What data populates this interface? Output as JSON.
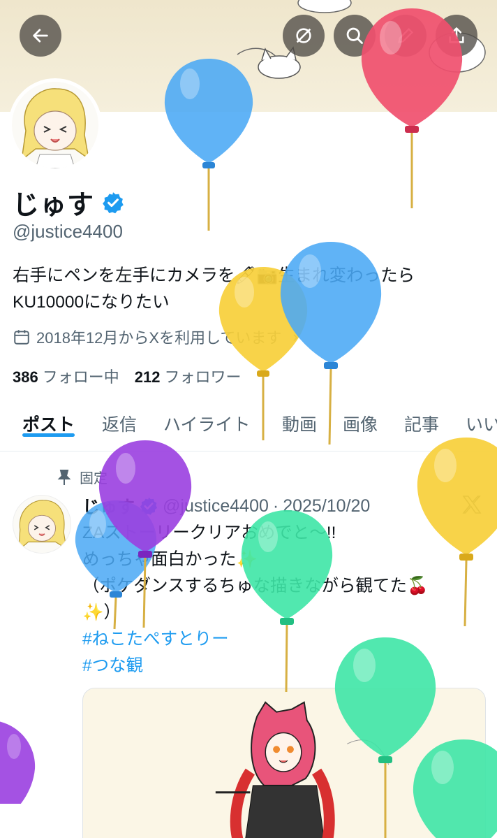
{
  "header": {
    "back_icon": "arrow-left-icon",
    "grok_icon": "circle-slash-icon",
    "search_icon": "search-icon",
    "edit_icon": "pencil-icon",
    "share_icon": "share-icon"
  },
  "profile": {
    "display_name": "じゅす",
    "handle": "@justice4400",
    "bio_line1": "右手にペンを左手にカメラを🖊📷生まれ変わったら",
    "bio_line2": "KU10000になりたい",
    "joined": "2018年12月からXを利用しています",
    "following_count": "386",
    "following_label": "フォロー中",
    "followers_count": "212",
    "followers_label": "フォロワー"
  },
  "tabs": [
    {
      "label": "ポスト",
      "active": true
    },
    {
      "label": "返信"
    },
    {
      "label": "ハイライト"
    },
    {
      "label": "動画"
    },
    {
      "label": "画像"
    },
    {
      "label": "記事"
    },
    {
      "label": "いいね"
    }
  ],
  "post": {
    "pinned_label": "固定",
    "author": "じゅす",
    "handle": "@justice4400",
    "date": "2025/10/20",
    "line1": "ZAストーリークリアおめでと〜!!",
    "line2": "めっちゃ面白かった✨",
    "line3": "（ポケダンスするちゅな描きながら観てた🍒",
    "line4": "✨）",
    "hashtag1": "#ねこたぺすとりー",
    "hashtag2": "#つな観"
  },
  "colors": {
    "accent": "#1d9bf0",
    "text": "#0f1419",
    "muted": "#536471",
    "balloon_blue": "#4aa8f5",
    "balloon_red": "#f04f6e",
    "balloon_yellow": "#f7cf3a",
    "balloon_purple": "#9a3fe0",
    "balloon_green": "#3ee6a6"
  }
}
